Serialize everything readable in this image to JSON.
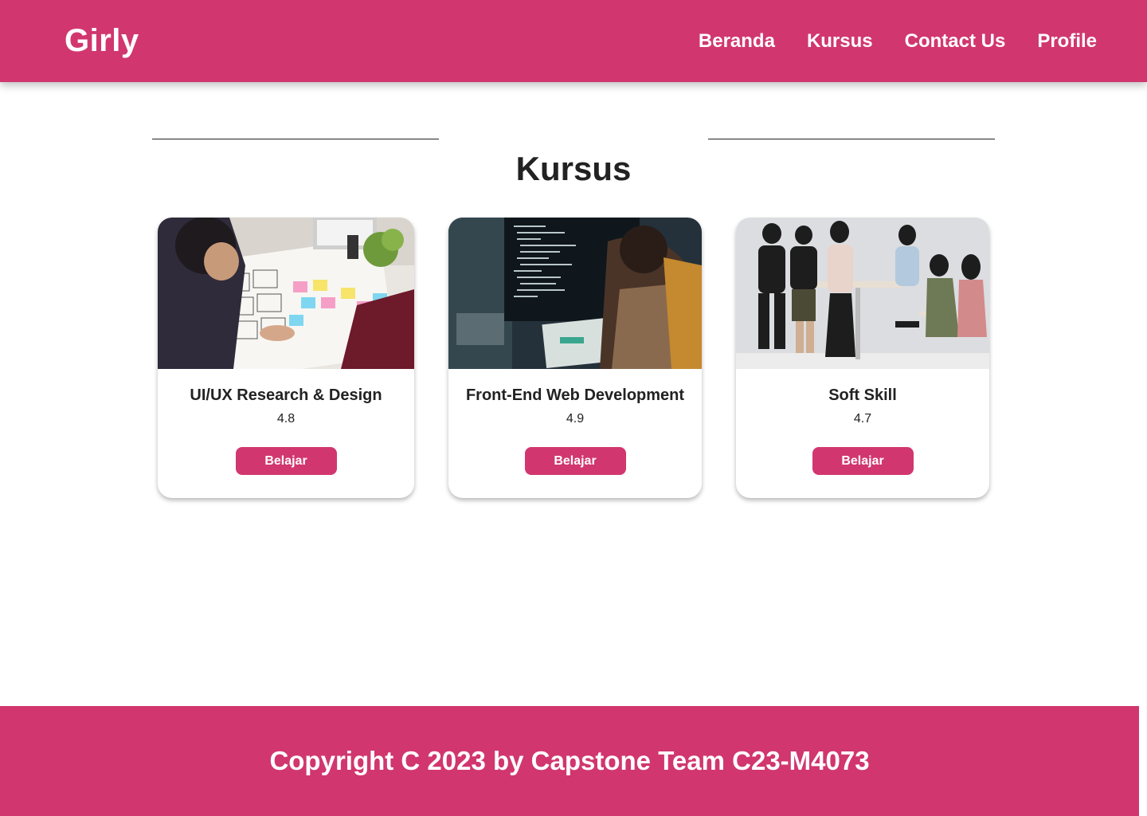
{
  "navbar": {
    "brand": "Girly",
    "links": [
      "Beranda",
      "Kursus",
      "Contact Us",
      "Profile"
    ],
    "background_color": "#d1366f"
  },
  "section": {
    "title": "Kursus"
  },
  "courses": [
    {
      "title": "UI/UX Research & Design",
      "rating": "4.8",
      "button_label": "Belajar",
      "image": "team-wireframing-photo"
    },
    {
      "title": "Front-End Web Development",
      "rating": "4.9",
      "button_label": "Belajar",
      "image": "developer-coding-photo"
    },
    {
      "title": "Soft Skill",
      "rating": "4.7",
      "button_label": "Belajar",
      "image": "team-discussion-photo"
    }
  ],
  "footer": {
    "text": "Copyright C 2023 by Capstone Team C23-M4073"
  }
}
